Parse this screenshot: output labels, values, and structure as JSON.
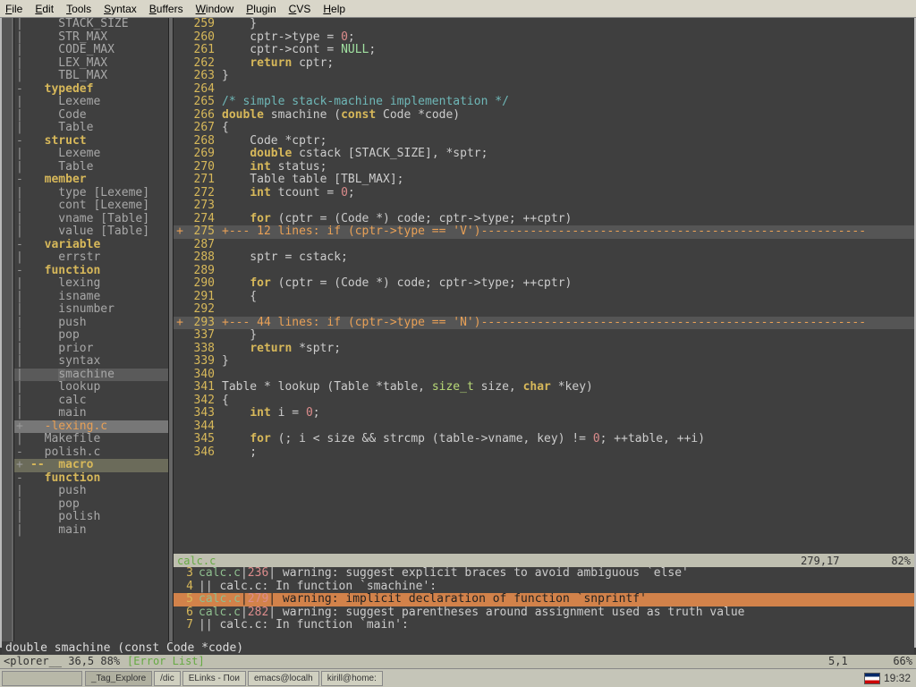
{
  "menu": [
    "File",
    "Edit",
    "Tools",
    "Syntax",
    "Buffers",
    "Window",
    "Plugin",
    "CVS",
    "Help"
  ],
  "sidebar": [
    {
      "f": "|",
      "t": "    STACK_SIZE",
      "c": "c-gray"
    },
    {
      "f": "|",
      "t": "    STR_MAX",
      "c": "c-gray"
    },
    {
      "f": "|",
      "t": "    CODE_MAX",
      "c": "c-gray"
    },
    {
      "f": "|",
      "t": "    LEX_MAX",
      "c": "c-gray"
    },
    {
      "f": "|",
      "t": "    TBL_MAX",
      "c": "c-gray"
    },
    {
      "f": "- ",
      "t": "  typedef",
      "c": "c-yel"
    },
    {
      "f": "|",
      "t": "    Lexeme",
      "c": "c-gray"
    },
    {
      "f": "|",
      "t": "    Code",
      "c": "c-gray"
    },
    {
      "f": "|",
      "t": "    Table",
      "c": "c-gray"
    },
    {
      "f": "- ",
      "t": "  struct",
      "c": "c-yel"
    },
    {
      "f": "|",
      "t": "    Lexeme",
      "c": "c-gray"
    },
    {
      "f": "|",
      "t": "    Table",
      "c": "c-gray"
    },
    {
      "f": "- ",
      "t": "  member",
      "c": "c-yel"
    },
    {
      "f": "|",
      "t": "    type [Lexeme]",
      "c": "c-gray"
    },
    {
      "f": "|",
      "t": "    cont [Lexeme]",
      "c": "c-gray"
    },
    {
      "f": "|",
      "t": "    vname [Table]",
      "c": "c-gray"
    },
    {
      "f": "|",
      "t": "    value [Table]",
      "c": "c-gray"
    },
    {
      "f": "- ",
      "t": "  variable",
      "c": "c-yel"
    },
    {
      "f": "|",
      "t": "    errstr",
      "c": "c-gray"
    },
    {
      "f": "- ",
      "t": "  function",
      "c": "c-yel"
    },
    {
      "f": "|",
      "t": "    lexing",
      "c": "c-gray"
    },
    {
      "f": "|",
      "t": "    isname",
      "c": "c-gray"
    },
    {
      "f": "|",
      "t": "    isnumber",
      "c": "c-gray"
    },
    {
      "f": "|",
      "t": "    push",
      "c": "c-gray"
    },
    {
      "f": "|",
      "t": "    pop",
      "c": "c-gray"
    },
    {
      "f": "|",
      "t": "    prior",
      "c": "c-gray"
    },
    {
      "f": "|",
      "t": "    syntax",
      "c": "c-gray"
    },
    {
      "f": "|",
      "t": "    smachine",
      "c": "c-gray",
      "sel": true,
      "cur": true
    },
    {
      "f": "|",
      "t": "    lookup",
      "c": "c-gray"
    },
    {
      "f": "|",
      "t": "    calc",
      "c": "c-gray"
    },
    {
      "f": "|",
      "t": "    main",
      "c": "c-gray"
    },
    {
      "f": "+ ",
      "t": "  -lexing.c",
      "c": "c-org",
      "hl": true
    },
    {
      "f": "|",
      "t": "  Makefile",
      "c": "c-gray"
    },
    {
      "f": "-",
      "t": "  polish.c",
      "c": "c-gray"
    },
    {
      "f": "+ ",
      "t": "--  macro",
      "c": "c-yel",
      "selm": true
    },
    {
      "f": "- ",
      "t": "  function",
      "c": "c-yel"
    },
    {
      "f": "|",
      "t": "    push",
      "c": "c-gray"
    },
    {
      "f": "|",
      "t": "    pop",
      "c": "c-gray"
    },
    {
      "f": "|",
      "t": "    polish",
      "c": "c-gray"
    },
    {
      "f": "|",
      "t": "    main",
      "c": "c-gray"
    }
  ],
  "code": [
    {
      "n": 259,
      "h": "    }"
    },
    {
      "n": 260,
      "h": "    cptr->type = <span class='nm'>0</span>;"
    },
    {
      "n": 261,
      "h": "    cptr->cont = <span class='nl'>NULL</span>;"
    },
    {
      "n": 262,
      "h": "    <span class='kw'>return</span> cptr;"
    },
    {
      "n": 263,
      "h": "}"
    },
    {
      "n": 264,
      "h": ""
    },
    {
      "n": 265,
      "h": "<span class='cm'>/* simple stack-machine implementation */</span>"
    },
    {
      "n": 266,
      "h": "<span class='kw'>double</span> smachine (<span class='kw'>const</span> Code *code)"
    },
    {
      "n": 267,
      "h": "{"
    },
    {
      "n": 268,
      "h": "    Code *cptr;"
    },
    {
      "n": 269,
      "h": "    <span class='kw'>double</span> cstack [STACK_SIZE], *sptr;"
    },
    {
      "n": 270,
      "h": "    <span class='kw'>int</span> status;"
    },
    {
      "n": 271,
      "h": "    Table table [TBL_MAX];"
    },
    {
      "n": 272,
      "h": "    <span class='kw'>int</span> tcount = <span class='nm'>0</span>;"
    },
    {
      "n": 273,
      "h": ""
    },
    {
      "n": 274,
      "h": "    <span class='kw'>for</span> (cptr = (Code *) code; cptr->type; ++cptr)"
    },
    {
      "n": 275,
      "h": "+--- 12 lines: if (cptr->type == 'V')-------------------------------------------------------",
      "fold": true
    },
    {
      "n": 287,
      "h": ""
    },
    {
      "n": 288,
      "h": "    sptr = cstack;"
    },
    {
      "n": 289,
      "h": ""
    },
    {
      "n": 290,
      "h": "    <span class='kw'>for</span> (cptr = (Code *) code; cptr->type; ++cptr)"
    },
    {
      "n": 291,
      "h": "    {"
    },
    {
      "n": 292,
      "h": ""
    },
    {
      "n": 293,
      "h": "+--- 44 lines: if (cptr->type == 'N')-------------------------------------------------------",
      "fold": true
    },
    {
      "n": 337,
      "h": "    }"
    },
    {
      "n": 338,
      "h": "    <span class='kw'>return</span> *sptr;"
    },
    {
      "n": 339,
      "h": "}"
    },
    {
      "n": 340,
      "h": ""
    },
    {
      "n": 341,
      "h": "Table * lookup (Table *table, <span class='ty'>size_t</span> size, <span class='kw'>char</span> *key)"
    },
    {
      "n": 342,
      "h": "{"
    },
    {
      "n": 343,
      "h": "    <span class='kw'>int</span> i = <span class='nm'>0</span>;"
    },
    {
      "n": 344,
      "h": ""
    },
    {
      "n": 345,
      "h": "    <span class='kw'>for</span> (; i < size && strcmp (table->vname, key) != <span class='nm'>0</span>; ++table, ++i)"
    },
    {
      "n": 346,
      "h": "    ;"
    }
  ],
  "status1": {
    "file": "calc.c",
    "pos": "279,17",
    "pct": "82%"
  },
  "errors": [
    {
      "n": 3,
      "f": "calc.c",
      "ln": "236",
      "m": " warning: suggest explicit braces to avoid ambiguous `else'"
    },
    {
      "n": 4,
      "f": "",
      "ln": "",
      "m": "|| calc.c: In function `smachine':"
    },
    {
      "n": 5,
      "f": "calc.c",
      "ln": "279",
      "m": " warning: implicit declaration of function `snprintf'",
      "sel": true
    },
    {
      "n": 6,
      "f": "calc.c",
      "ln": "282",
      "m": " warning: suggest parentheses around assignment used as truth value"
    },
    {
      "n": 7,
      "f": "",
      "ln": "",
      "m": "|| calc.c: In function `main':"
    }
  ],
  "bottom": {
    "left": "<plorer__ 36,5   88%",
    "mid": "[Error List]",
    "pos": "5,1",
    "pct": "66%"
  },
  "cmdline": "double smachine (const Code *code)",
  "taskbar": {
    "items": [
      "_Tag_Explore",
      "/dic",
      "ELinks - Пои",
      "emacs@localh",
      "kirill@home:"
    ],
    "time": "19:32"
  }
}
